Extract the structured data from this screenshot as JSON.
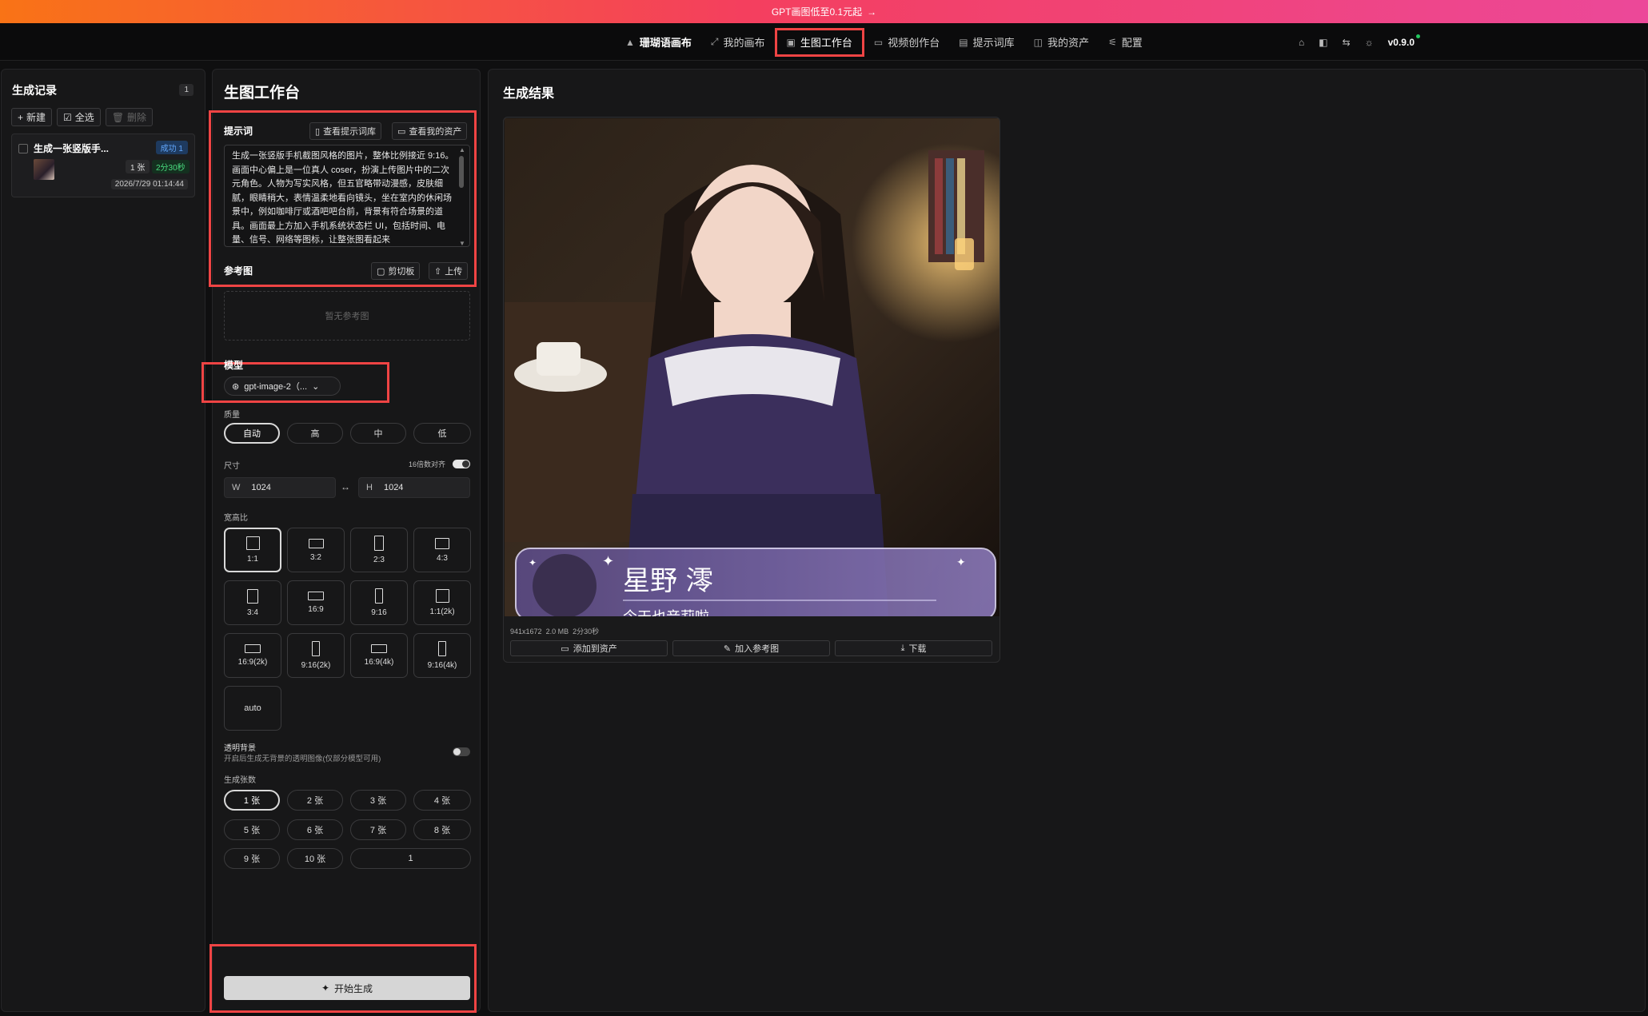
{
  "promo": {
    "text": "GPT画图低至0.1元起",
    "arrow": "→"
  },
  "nav": {
    "brand": "珊瑚语画布",
    "items": [
      {
        "label": "我的画布",
        "icon": "expand-icon"
      },
      {
        "label": "生图工作台",
        "icon": "image-icon",
        "active": true
      },
      {
        "label": "视频创作台",
        "icon": "video-icon"
      },
      {
        "label": "提示词库",
        "icon": "document-icon"
      },
      {
        "label": "我的资产",
        "icon": "assets-icon"
      },
      {
        "label": "配置",
        "icon": "sliders-icon"
      }
    ],
    "version": "v0.9.0"
  },
  "history": {
    "title": "生成记录",
    "count": "1",
    "new_label": "新建",
    "select_all_label": "全选",
    "delete_label": "删除",
    "item": {
      "title": "生成一张竖版手...",
      "status": "成功 1",
      "num": "1 张",
      "duration": "2分30秒",
      "time": "2026/7/29 01:14:44"
    }
  },
  "work": {
    "title": "生图工作台",
    "prompt_label": "提示词",
    "view_library": "查看提示词库",
    "view_assets": "查看我的资产",
    "prompt_text": "生成一张竖版手机截图风格的图片，整体比例接近 9:16。画面中心偏上是一位真人 coser，扮演上传图片中的二次元角色。人物为写实风格，但五官略带动漫感，皮肤细腻，眼睛稍大，表情温柔地看向镜头，坐在室内的休闲场景中，例如咖啡厅或酒吧吧台前，背景有符合场景的道具。画面最上方加入手机系统状态栏 UI，包括时间、电量、信号、网络等图标，让整张图看起来",
    "ref_label": "参考图",
    "clipboard": "剪切板",
    "upload": "上传",
    "ref_empty": "暂无参考图",
    "model_label": "模型",
    "model_value": "gpt-image-2（...",
    "quality_label": "质量",
    "quality_options": [
      "自动",
      "高",
      "中",
      "低"
    ],
    "size_label": "尺寸",
    "align16_label": "16倍数对齐",
    "w_prefix": "W",
    "w_value": "1024",
    "h_prefix": "H",
    "h_value": "1024",
    "swap": "↔",
    "ratio_label": "宽高比",
    "ratios": [
      "1:1",
      "3:2",
      "2:3",
      "4:3",
      "3:4",
      "16:9",
      "9:16",
      "1:1(2k)",
      "16:9(2k)",
      "9:16(2k)",
      "16:9(4k)",
      "9:16(4k)",
      "auto"
    ],
    "transparent_label": "透明背景",
    "transparent_desc": "开启后生成无背景的透明图像(仅部分模型可用)",
    "count_label": "生成张数",
    "count_options": [
      "1 张",
      "2 张",
      "3 张",
      "4 张",
      "5 张",
      "6 张",
      "7 张",
      "8 张",
      "9 张",
      "10 张"
    ],
    "count_custom": "1",
    "generate_label": "开始生成"
  },
  "result": {
    "title": "生成结果",
    "overlay_name": "星野 澪",
    "overlay_sub": "今天也音莉啦",
    "meta_size": "941x1672",
    "meta_file": "2.0 MB",
    "meta_time": "2分30秒",
    "add_asset": "添加到资产",
    "add_ref": "加入参考图",
    "download": "下载"
  },
  "colors": {
    "accent_red": "#ef4444",
    "promo_start": "#f97316",
    "promo_end": "#ec4899",
    "success": "#4ade80"
  }
}
